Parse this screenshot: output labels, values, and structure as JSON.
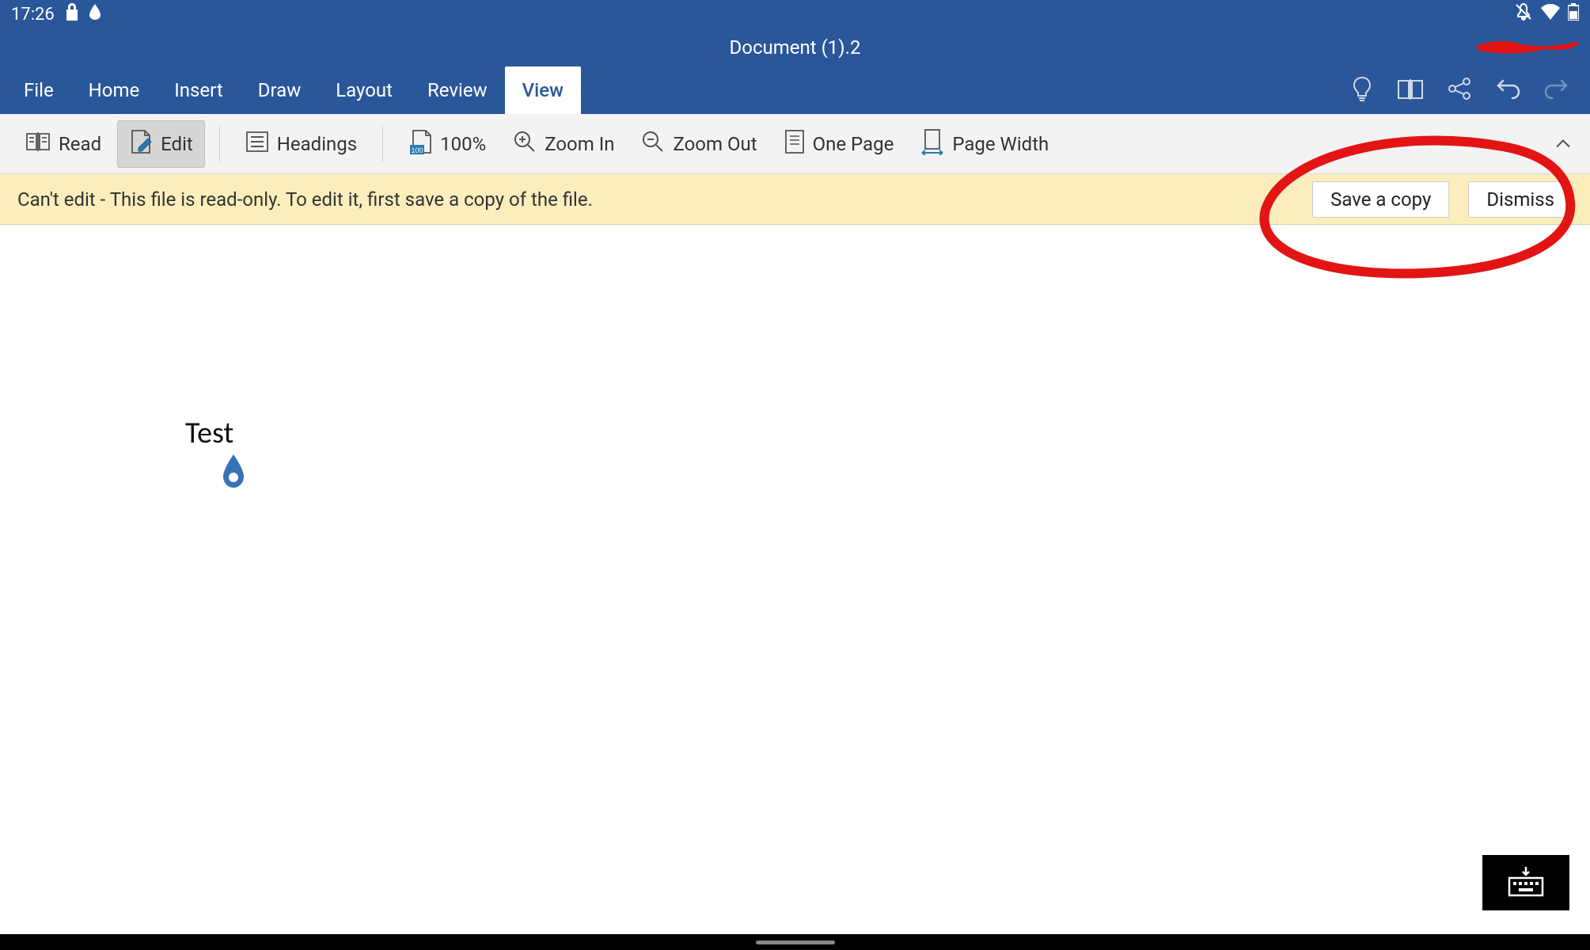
{
  "status": {
    "time": "17:26"
  },
  "title": "Document (1).2",
  "tabs": {
    "file": "File",
    "home": "Home",
    "insert": "Insert",
    "draw": "Draw",
    "layout": "Layout",
    "review": "Review",
    "view": "View"
  },
  "ribbon": {
    "read": "Read",
    "edit": "Edit",
    "headings": "Headings",
    "zoom_percent": "100%",
    "zoom_in": "Zoom In",
    "zoom_out": "Zoom Out",
    "one_page": "One Page",
    "page_width": "Page Width"
  },
  "info_bar": {
    "message": "Can't edit - This file is read-only. To edit it, first save a copy of the file.",
    "save_copy": "Save a copy",
    "dismiss": "Dismiss"
  },
  "document": {
    "content": "Test"
  }
}
